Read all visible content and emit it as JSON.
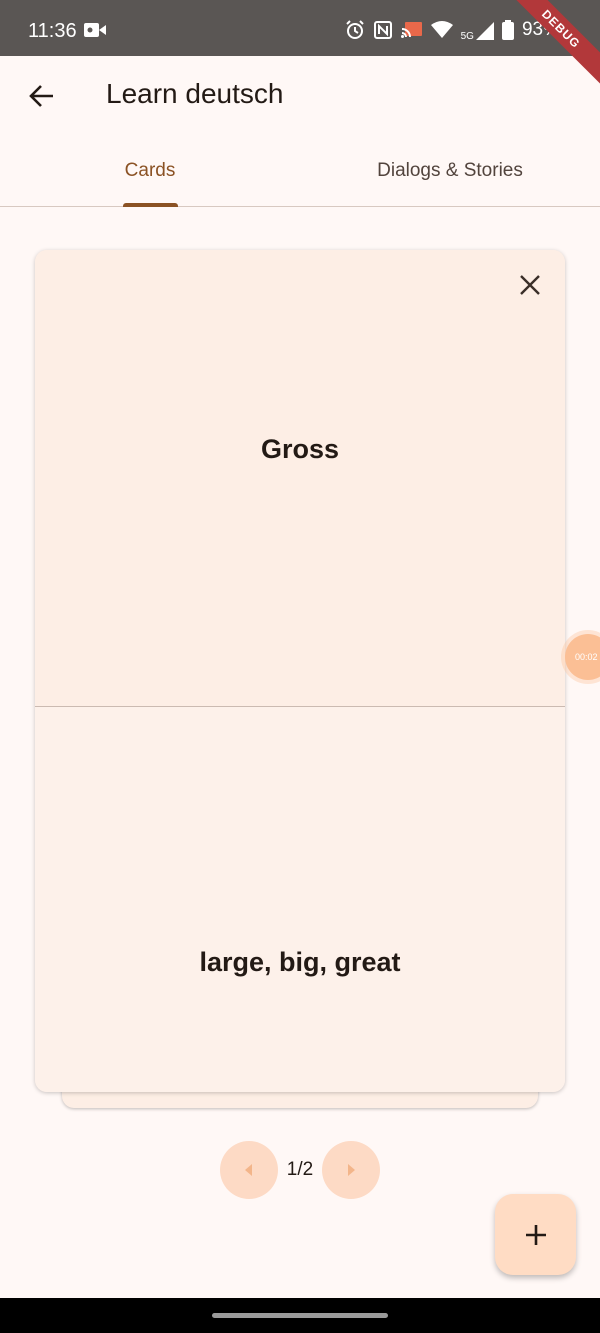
{
  "status_bar": {
    "time": "11:36",
    "network": "5G",
    "battery": "93%",
    "debug_banner": "DEBUG"
  },
  "app_bar": {
    "title": "Learn deutsch",
    "back_icon": "arrow-back-icon"
  },
  "tabs": [
    {
      "label": "Cards",
      "selected": true
    },
    {
      "label": "Dialogs & Stories",
      "selected": false
    }
  ],
  "card": {
    "front": "Gross",
    "back": "large, big, great",
    "close_icon": "close-icon"
  },
  "floating_bubble": {
    "text": "00:02"
  },
  "pager": {
    "current": "1/2",
    "prev_icon": "caret-left-icon",
    "next_icon": "caret-right-icon"
  },
  "fab": {
    "icon": "plus-icon"
  },
  "colors": {
    "background": "#fff8f6",
    "accent": "#8b5224",
    "card": "#fdeee5",
    "button": "#fddac5",
    "fab": "#ffdcc4"
  }
}
